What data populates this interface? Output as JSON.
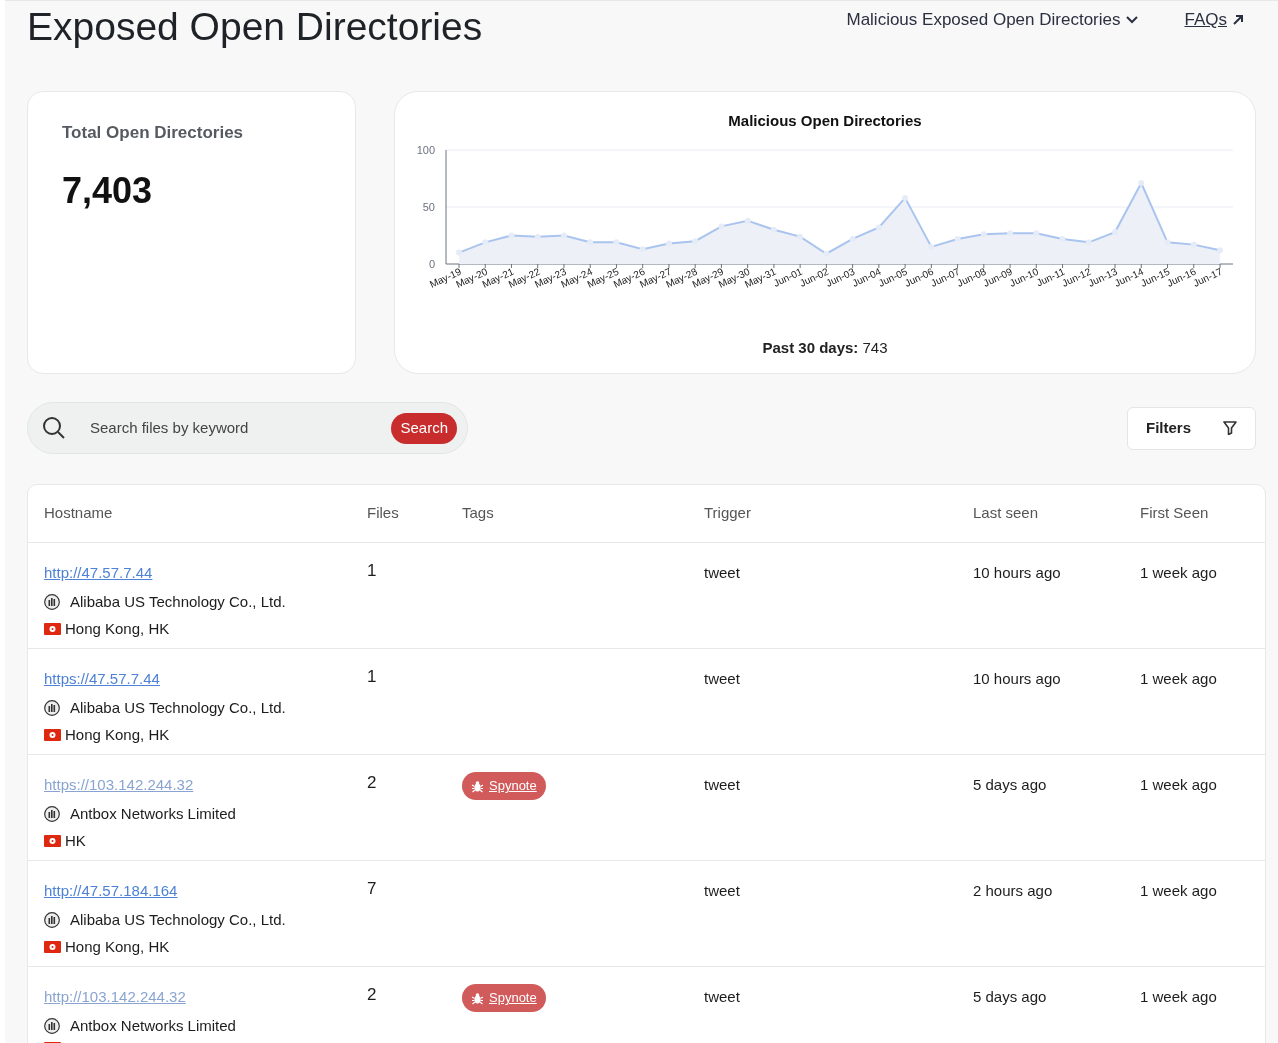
{
  "page": {
    "title": "Exposed Open Directories"
  },
  "nav": {
    "menu": "Malicious Exposed Open Directories",
    "faqs": "FAQs"
  },
  "total_card": {
    "label": "Total Open Directories",
    "value": "7,403"
  },
  "chart_card": {
    "footer_label": "Past 30 days:",
    "footer_value": "743",
    "chart_data": {
      "type": "area",
      "title": "Malicious Open Directories",
      "categories": [
        "May-19",
        "May-20",
        "May-21",
        "May-22",
        "May-23",
        "May-24",
        "May-25",
        "May-26",
        "May-27",
        "May-28",
        "May-29",
        "May-30",
        "May-31",
        "Jun-01",
        "Jun-02",
        "Jun-03",
        "Jun-04",
        "Jun-05",
        "Jun-06",
        "Jun-07",
        "Jun-08",
        "Jun-09",
        "Jun-10",
        "Jun-11",
        "Jun-12",
        "Jun-13",
        "Jun-14",
        "Jun-15",
        "Jun-16",
        "Jun-17"
      ],
      "series": [
        {
          "color": "#a9c4ee",
          "values": [
            10,
            19,
            25,
            24,
            25,
            19,
            19,
            13,
            18,
            20,
            33,
            38,
            30,
            24,
            9,
            22,
            32,
            58,
            15,
            22,
            26,
            27,
            27,
            22,
            19,
            28,
            71,
            19,
            17,
            12
          ]
        }
      ],
      "ylim": [
        0,
        100
      ],
      "yticks": [
        0,
        50,
        100
      ]
    }
  },
  "search": {
    "placeholder": "Search files by keyword",
    "button": "Search"
  },
  "filters": {
    "label": "Filters"
  },
  "table": {
    "columns": [
      "Hostname",
      "Files",
      "Tags",
      "Trigger",
      "Last seen",
      "First Seen"
    ],
    "rows": [
      {
        "url": "http://47.57.7.44",
        "visited": false,
        "org": "Alibaba US Technology Co., Ltd.",
        "location": "Hong Kong, HK",
        "files": "1",
        "tags": [],
        "trigger": "tweet",
        "last_seen": "10 hours ago",
        "first_seen": "1 week ago"
      },
      {
        "url": "https://47.57.7.44",
        "visited": false,
        "org": "Alibaba US Technology Co., Ltd.",
        "location": "Hong Kong, HK",
        "files": "1",
        "tags": [],
        "trigger": "tweet",
        "last_seen": "10 hours ago",
        "first_seen": "1 week ago"
      },
      {
        "url": "https://103.142.244.32",
        "visited": true,
        "org": "Antbox Networks Limited",
        "location": "HK",
        "files": "2",
        "tags": [
          "Spynote"
        ],
        "trigger": "tweet",
        "last_seen": "5 days ago",
        "first_seen": "1 week ago"
      },
      {
        "url": "http://47.57.184.164",
        "visited": false,
        "org": "Alibaba US Technology Co., Ltd.",
        "location": "Hong Kong, HK",
        "files": "7",
        "tags": [],
        "trigger": "tweet",
        "last_seen": "2 hours ago",
        "first_seen": "1 week ago"
      },
      {
        "url": "http://103.142.244.32",
        "visited": true,
        "org": "Antbox Networks Limited",
        "files": "2",
        "tags": [
          "Spynote"
        ],
        "trigger": "tweet",
        "last_seen": "5 days ago",
        "first_seen": "1 week ago"
      }
    ]
  }
}
